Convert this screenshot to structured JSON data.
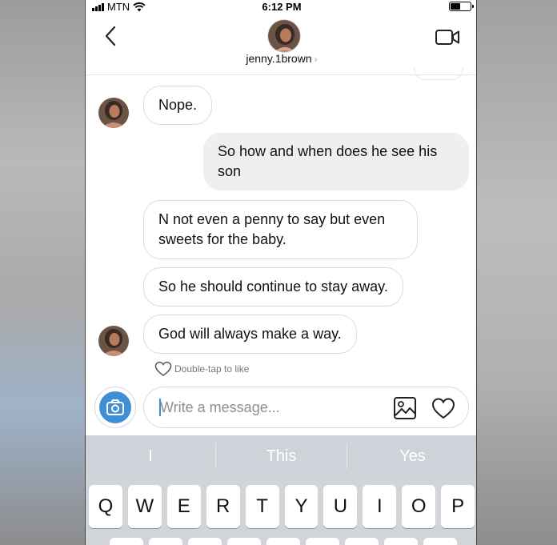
{
  "status_bar": {
    "carrier": "MTN",
    "time": "6:12 PM",
    "battery_level": 0.45
  },
  "header": {
    "username": "jenny.1brown",
    "chevron": "›"
  },
  "messages": [
    {
      "side": "incoming",
      "text": "Nope."
    },
    {
      "side": "outgoing",
      "text": "So how and when does he see his son"
    },
    {
      "side": "incoming",
      "text": "N not even a penny to say but even sweets for the baby."
    },
    {
      "side": "incoming",
      "text": "So he should continue to stay away."
    },
    {
      "side": "incoming",
      "text": "God will always make a way."
    }
  ],
  "like_hint": "Double-tap to like",
  "composer": {
    "placeholder": "Write a message..."
  },
  "keyboard": {
    "suggestions": [
      "I",
      "This",
      "Yes"
    ],
    "row1": [
      "Q",
      "W",
      "E",
      "R",
      "T",
      "Y",
      "U",
      "I",
      "O",
      "P"
    ]
  },
  "colors": {
    "accent": "#3e8fd8",
    "outgoing_bubble": "#efefef",
    "keyboard": "#d1d4d9"
  }
}
